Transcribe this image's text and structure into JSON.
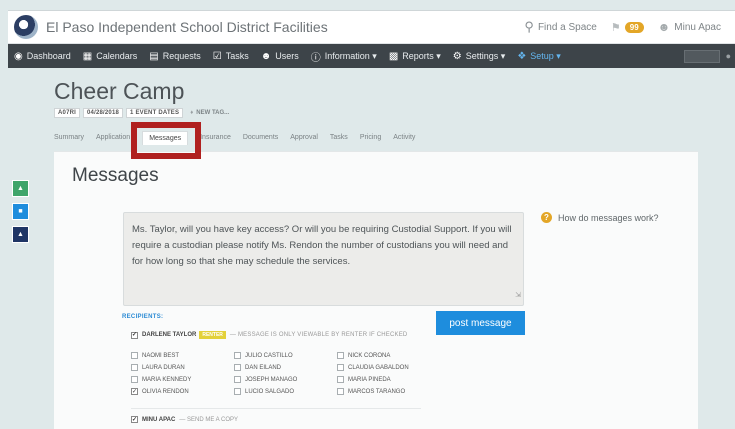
{
  "topbar": {
    "title": "El Paso Independent School District Facilities",
    "find_label": "Find a Space",
    "badge_count": "99",
    "user_name": "Minu Apac"
  },
  "nav": {
    "items": [
      {
        "label": "Dashboard",
        "icon": "dashboard-icon"
      },
      {
        "label": "Calendars",
        "icon": "calendar-icon"
      },
      {
        "label": "Requests",
        "icon": "document-icon"
      },
      {
        "label": "Tasks",
        "icon": "checkbox-icon"
      },
      {
        "label": "Users",
        "icon": "users-icon"
      },
      {
        "label": "Information ▾",
        "icon": "info-icon"
      },
      {
        "label": "Reports ▾",
        "icon": "bar-chart-icon"
      },
      {
        "label": "Settings ▾",
        "icon": "gear-icon"
      },
      {
        "label": "Setup ▾",
        "icon": "wrench-icon"
      }
    ]
  },
  "header": {
    "title": "Cheer Camp",
    "request_id": "A07RI",
    "date": "04/28/2018",
    "event_dates": "1 EVENT DATES",
    "new_tag": "NEW TAG..."
  },
  "tabs": [
    "Summary",
    "Application",
    "Messages",
    "Insurance",
    "Documents",
    "Approval",
    "Tasks",
    "Pricing",
    "Activity"
  ],
  "active_tab": "Messages",
  "colors": {
    "highlight": "#b0201f",
    "primary": "#1e8ddd",
    "navbar": "#3d4449",
    "green": "#3fa56a",
    "navy": "#1f3565"
  },
  "main": {
    "heading": "Messages",
    "help_text": "How do messages work?",
    "message_text": "Ms. Taylor, will you have key access?  Or will you be requiring Custodial Support.  If you will require a custodian please notify Ms. Rendon the number of custodians you will need and for how long so that she may schedule the services.",
    "post_button": "post message",
    "recipients_label": "RECIPIENTS:",
    "primary_recipient": "DARLENE TAYLOR",
    "renter_badge": "RENTER",
    "viewable_note": "— MESSAGE IS ONLY VIEWABLE BY RENTER IF CHECKED",
    "recipients": [
      {
        "name": "NAOMI BEST",
        "checked": false
      },
      {
        "name": "JULIO CASTILLO",
        "checked": false
      },
      {
        "name": "NICK CORONA",
        "checked": false
      },
      {
        "name": "LAURA DURAN",
        "checked": false
      },
      {
        "name": "DAN EILAND",
        "checked": false
      },
      {
        "name": "CLAUDIA GABALDON",
        "checked": false
      },
      {
        "name": "MARIA KENNEDY",
        "checked": false
      },
      {
        "name": "JOSEPH MANAGO",
        "checked": false
      },
      {
        "name": "MARIA PINEDA",
        "checked": false
      },
      {
        "name": "OLIVIA RENDON",
        "checked": true
      },
      {
        "name": "LUCIO SALGADO",
        "checked": false
      },
      {
        "name": "MARCOS TARANGO",
        "checked": false
      }
    ],
    "self_recipient": "MINU APAC",
    "self_note": "— SEND ME A COPY"
  }
}
